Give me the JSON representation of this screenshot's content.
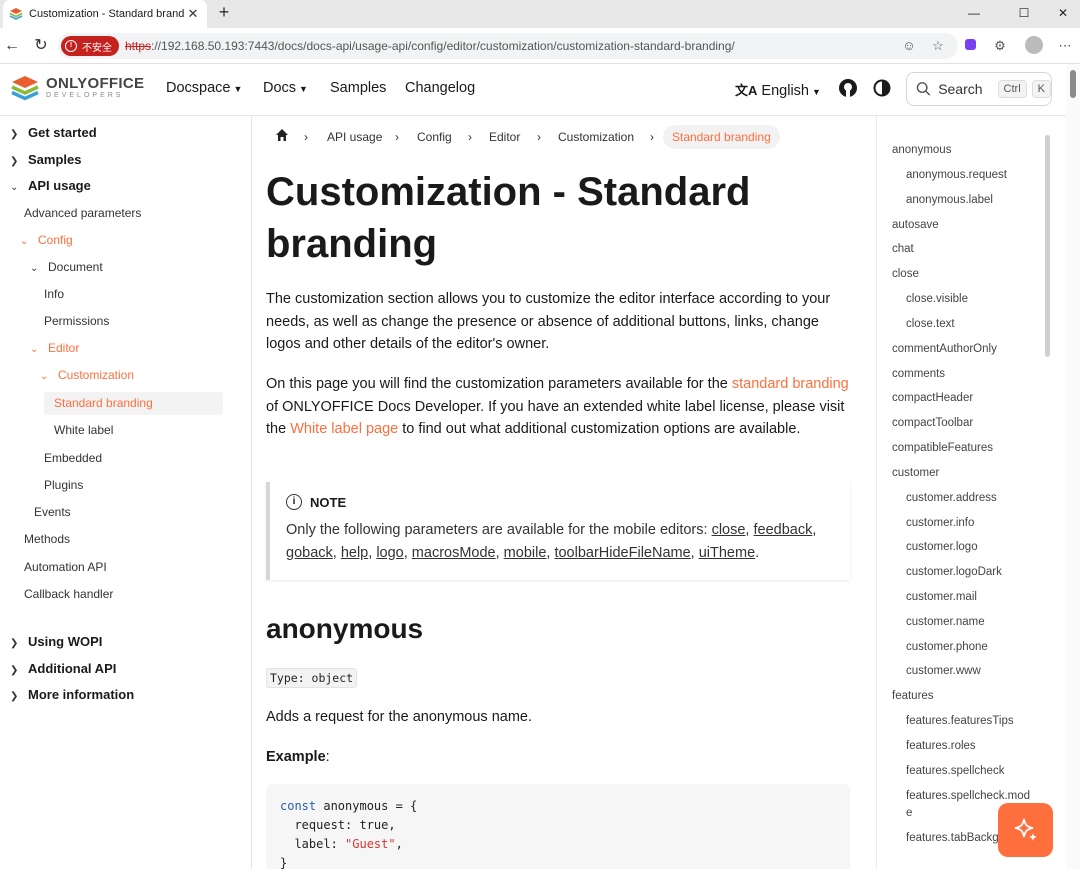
{
  "browser": {
    "tab_title": "Customization - Standard branding",
    "tab_close": "✕",
    "new_tab": "+",
    "security_badge": "不安全",
    "url_protocol": "https",
    "url_rest": "://192.168.50.193:7443/docs/docs-api/usage-api/config/editor/customization/customization-standard-branding/"
  },
  "header": {
    "logo_top": "ONLYOFFICE",
    "logo_bottom": "DEVELOPERS",
    "nav": [
      "Docspace",
      "Docs",
      "Samples",
      "Changelog"
    ],
    "language": "English",
    "search_label": "Search",
    "search_kbd1": "Ctrl",
    "search_kbd2": "K"
  },
  "sidebar": {
    "items": [
      {
        "label": "Get started"
      },
      {
        "label": "Samples"
      },
      {
        "label": "API usage"
      },
      {
        "label": "Advanced parameters"
      },
      {
        "label": "Config"
      },
      {
        "label": "Document"
      },
      {
        "label": "Info"
      },
      {
        "label": "Permissions"
      },
      {
        "label": "Editor"
      },
      {
        "label": "Customization"
      },
      {
        "label": "Standard branding"
      },
      {
        "label": "White label"
      },
      {
        "label": "Embedded"
      },
      {
        "label": "Plugins"
      },
      {
        "label": "Events"
      },
      {
        "label": "Methods"
      },
      {
        "label": "Automation API"
      },
      {
        "label": "Callback handler"
      },
      {
        "label": "Using WOPI"
      },
      {
        "label": "Additional API"
      },
      {
        "label": "More information"
      }
    ]
  },
  "breadcrumb": [
    "API usage",
    "Config",
    "Editor",
    "Customization",
    "Standard branding"
  ],
  "main": {
    "title": "Customization - Standard branding",
    "intro": "The customization section allows you to customize the editor interface according to your needs, as well as change the presence or absence of additional buttons, links, change logos and other details of the editor's owner.",
    "p2_a": "On this page you will find the customization parameters available for the ",
    "p2_link1": "standard branding",
    "p2_b": " of ONLYOFFICE Docs Developer. If you have an extended white label license, please visit the ",
    "p2_link2": "White label page",
    "p2_c": " to find out what additional customization options are available.",
    "note_title": "NOTE",
    "note_text": "Only the following parameters are available for the mobile editors: ",
    "note_links": [
      "close",
      "feedback",
      "goback",
      "help",
      "logo",
      "macrosMode",
      "mobile",
      "toolbarHideFileName",
      "uiTheme"
    ],
    "section_title": "anonymous",
    "type_label": "Type: object",
    "section_desc": "Adds a request for the anonymous name.",
    "example_label": "Example",
    "code": {
      "l1_kw": "const",
      "l1_rest": " anonymous = {",
      "l2": "  request: true,",
      "l3_a": "  label: ",
      "l3_str": "\"Guest\"",
      "l3_b": ",",
      "l4": "}"
    }
  },
  "toc": [
    "anonymous",
    "anonymous.request",
    "anonymous.label",
    "autosave",
    "chat",
    "close",
    "close.visible",
    "close.text",
    "commentAuthorOnly",
    "comments",
    "compactHeader",
    "compactToolbar",
    "compatibleFeatures",
    "customer",
    "customer.address",
    "customer.info",
    "customer.logo",
    "customer.logoDark",
    "customer.mail",
    "customer.name",
    "customer.phone",
    "customer.www",
    "features",
    "features.featuresTips",
    "features.roles",
    "features.spellcheck",
    "features.spellcheck.mod",
    "e",
    "features.tabBackg"
  ],
  "colors": {
    "accent": "#ff6f3d",
    "badge": "#c5221f"
  }
}
